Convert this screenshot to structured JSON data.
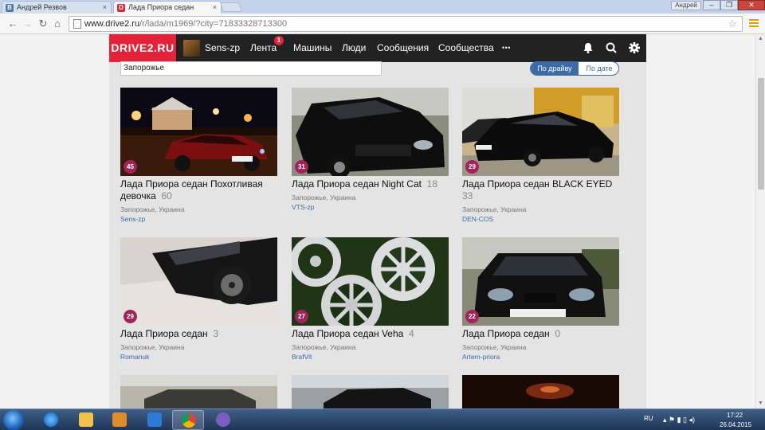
{
  "browser": {
    "tabs": [
      {
        "title": "Андрей Резвов",
        "favicon_letter": "B",
        "favicon_color": "#4a76a8",
        "active": false
      },
      {
        "title": "Лада Приора седан",
        "favicon_letter": "D",
        "favicon_color": "#e4233b",
        "active": true
      }
    ],
    "user_name": "Андрей",
    "url_host": "www.drive2.ru",
    "url_path": "/r/lada/m1969/?city=71833328713300"
  },
  "site": {
    "logo": "DRIVE2.RU",
    "nav": {
      "user": "Sens-zp",
      "feed": "Лента",
      "feed_badge": "1",
      "cars": "Машины",
      "people": "Люди",
      "messages": "Сообщения",
      "communities": "Сообщества",
      "more": "• • •"
    },
    "search_value": "Запорожье",
    "sort": {
      "by_drive": "По драйву",
      "by_date": "По дате"
    },
    "accent_color": "#e4233b",
    "link_color": "#3c6aa6",
    "badge_color": "#a0245a"
  },
  "cards": [
    {
      "name": "Лада Приора седан Похотливая девочка",
      "count": "60",
      "photos": "45",
      "location": "Запорожье, Украина",
      "author": "Sens-zp"
    },
    {
      "name": "Лада Приора седан Night Cat",
      "count": "18",
      "photos": "31",
      "location": "Запорожье, Украина",
      "author": "VTS-zp"
    },
    {
      "name": "Лада Приора седан BLACK EYED",
      "count": "33",
      "photos": "29",
      "location": "Запорожье, Украина",
      "author": "DEN-COS"
    },
    {
      "name": "Лада Приора седан",
      "count": "3",
      "photos": "29",
      "location": "Запорожье, Украина",
      "author": "Romanuk"
    },
    {
      "name": "Лада Приора седан Veha",
      "count": "4",
      "photos": "27",
      "location": "Запорожье, Украина",
      "author": "BrafVit"
    },
    {
      "name": "Лада Приора седан",
      "count": "0",
      "photos": "22",
      "location": "Запорожье, Украина",
      "author": "Artem-priora"
    }
  ],
  "taskbar": {
    "lang": "RU",
    "time": "17:22",
    "date": "26.04.2015"
  }
}
